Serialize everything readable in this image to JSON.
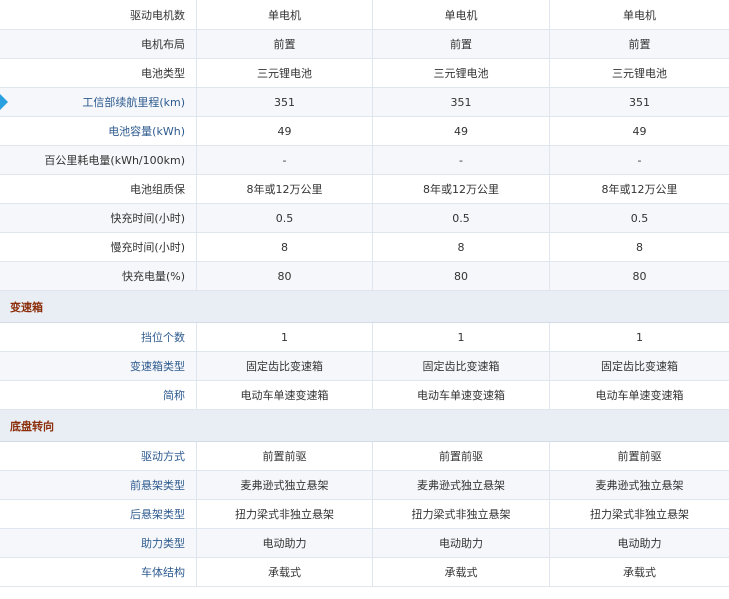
{
  "table": {
    "rows_block_1": [
      {
        "label": "驱动电机数",
        "values": [
          "单电机",
          "单电机",
          "单电机"
        ],
        "link": false
      },
      {
        "label": "电机布局",
        "values": [
          "前置",
          "前置",
          "前置"
        ],
        "link": false
      },
      {
        "label": "电池类型",
        "values": [
          "三元锂电池",
          "三元锂电池",
          "三元锂电池"
        ],
        "link": false
      },
      {
        "label": "工信部续航里程(km)",
        "values": [
          "351",
          "351",
          "351"
        ],
        "link": true
      },
      {
        "label": "电池容量(kWh)",
        "values": [
          "49",
          "49",
          "49"
        ],
        "link": true
      },
      {
        "label": "百公里耗电量(kWh/100km)",
        "values": [
          "-",
          "-",
          "-"
        ],
        "link": false
      },
      {
        "label": "电池组质保",
        "values": [
          "8年或12万公里",
          "8年或12万公里",
          "8年或12万公里"
        ],
        "link": false
      },
      {
        "label": "快充时间(小时)",
        "values": [
          "0.5",
          "0.5",
          "0.5"
        ],
        "link": false
      },
      {
        "label": "慢充时间(小时)",
        "values": [
          "8",
          "8",
          "8"
        ],
        "link": false
      },
      {
        "label": "快充电量(%)",
        "values": [
          "80",
          "80",
          "80"
        ],
        "link": false
      }
    ],
    "section_gearbox": "变速箱",
    "rows_block_2": [
      {
        "label": "挡位个数",
        "values": [
          "1",
          "1",
          "1"
        ],
        "link": true
      },
      {
        "label": "变速箱类型",
        "values": [
          "固定齿比变速箱",
          "固定齿比变速箱",
          "固定齿比变速箱"
        ],
        "link": true
      },
      {
        "label": "简称",
        "values": [
          "电动车单速变速箱",
          "电动车单速变速箱",
          "电动车单速变速箱"
        ],
        "link": true
      }
    ],
    "section_chassis": "底盘转向",
    "rows_block_3": [
      {
        "label": "驱动方式",
        "values": [
          "前置前驱",
          "前置前驱",
          "前置前驱"
        ],
        "link": true
      },
      {
        "label": "前悬架类型",
        "values": [
          "麦弗逊式独立悬架",
          "麦弗逊式独立悬架",
          "麦弗逊式独立悬架"
        ],
        "link": true
      },
      {
        "label": "后悬架类型",
        "values": [
          "扭力梁式非独立悬架",
          "扭力梁式非独立悬架",
          "扭力梁式非独立悬架"
        ],
        "link": true
      },
      {
        "label": "助力类型",
        "values": [
          "电动助力",
          "电动助力",
          "电动助力"
        ],
        "link": true
      },
      {
        "label": "车体结构",
        "values": [
          "承载式",
          "承载式",
          "承载式"
        ],
        "link": true
      }
    ]
  },
  "colors": {
    "link": "#2e5b8f",
    "section_text": "#8b2e0a",
    "section_bg": "#e9eef5",
    "indicator": "#2aa0e0"
  }
}
